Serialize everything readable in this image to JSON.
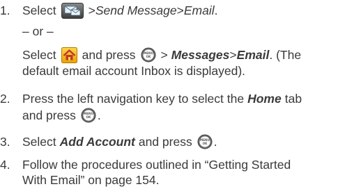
{
  "steps": [
    {
      "number": "1.",
      "lines": [
        {
          "t1": "Select",
          "icon": "mail-menu-icon",
          "sep1": ">",
          "e1": "Send Message",
          "sep2": ">",
          "e2": "Email",
          "end": "."
        },
        {
          "text": "– or –"
        },
        {
          "t1": "Select",
          "icon": "home-icon",
          "t2": "and press",
          "icon2": "menu-ok-key-icon",
          "sep1": ">",
          "e1": "Messages",
          "sep2": ">",
          "e2": "Email",
          "end": ". (The"
        },
        {
          "text": "default email account Inbox is displayed)."
        }
      ]
    },
    {
      "number": "2.",
      "lines": [
        {
          "t1": "Press the left navigation key to select the",
          "e1": "Home",
          "t2": "tab"
        },
        {
          "t1": "and press",
          "icon": "menu-ok-key-icon",
          "end": "."
        }
      ]
    },
    {
      "number": "3.",
      "lines": [
        {
          "t1": "Select",
          "e1": "Add Account",
          "t2": "and press",
          "icon": "menu-ok-key-icon",
          "end": "."
        }
      ]
    },
    {
      "number": "4.",
      "lines": [
        {
          "text": "Follow the procedures outlined in “Getting Started"
        },
        {
          "text": "With Email” on page 154."
        }
      ]
    }
  ],
  "icons": {
    "menu_ok_top": "MENU",
    "menu_ok_bottom": "OK"
  },
  "colors": {
    "text": "#3a3a3a",
    "home_icon_bg": "#f5b800",
    "home_icon_house": "#c0392b",
    "mail_icon_bg": "#555555",
    "menu_key": "#6a6a6a"
  }
}
